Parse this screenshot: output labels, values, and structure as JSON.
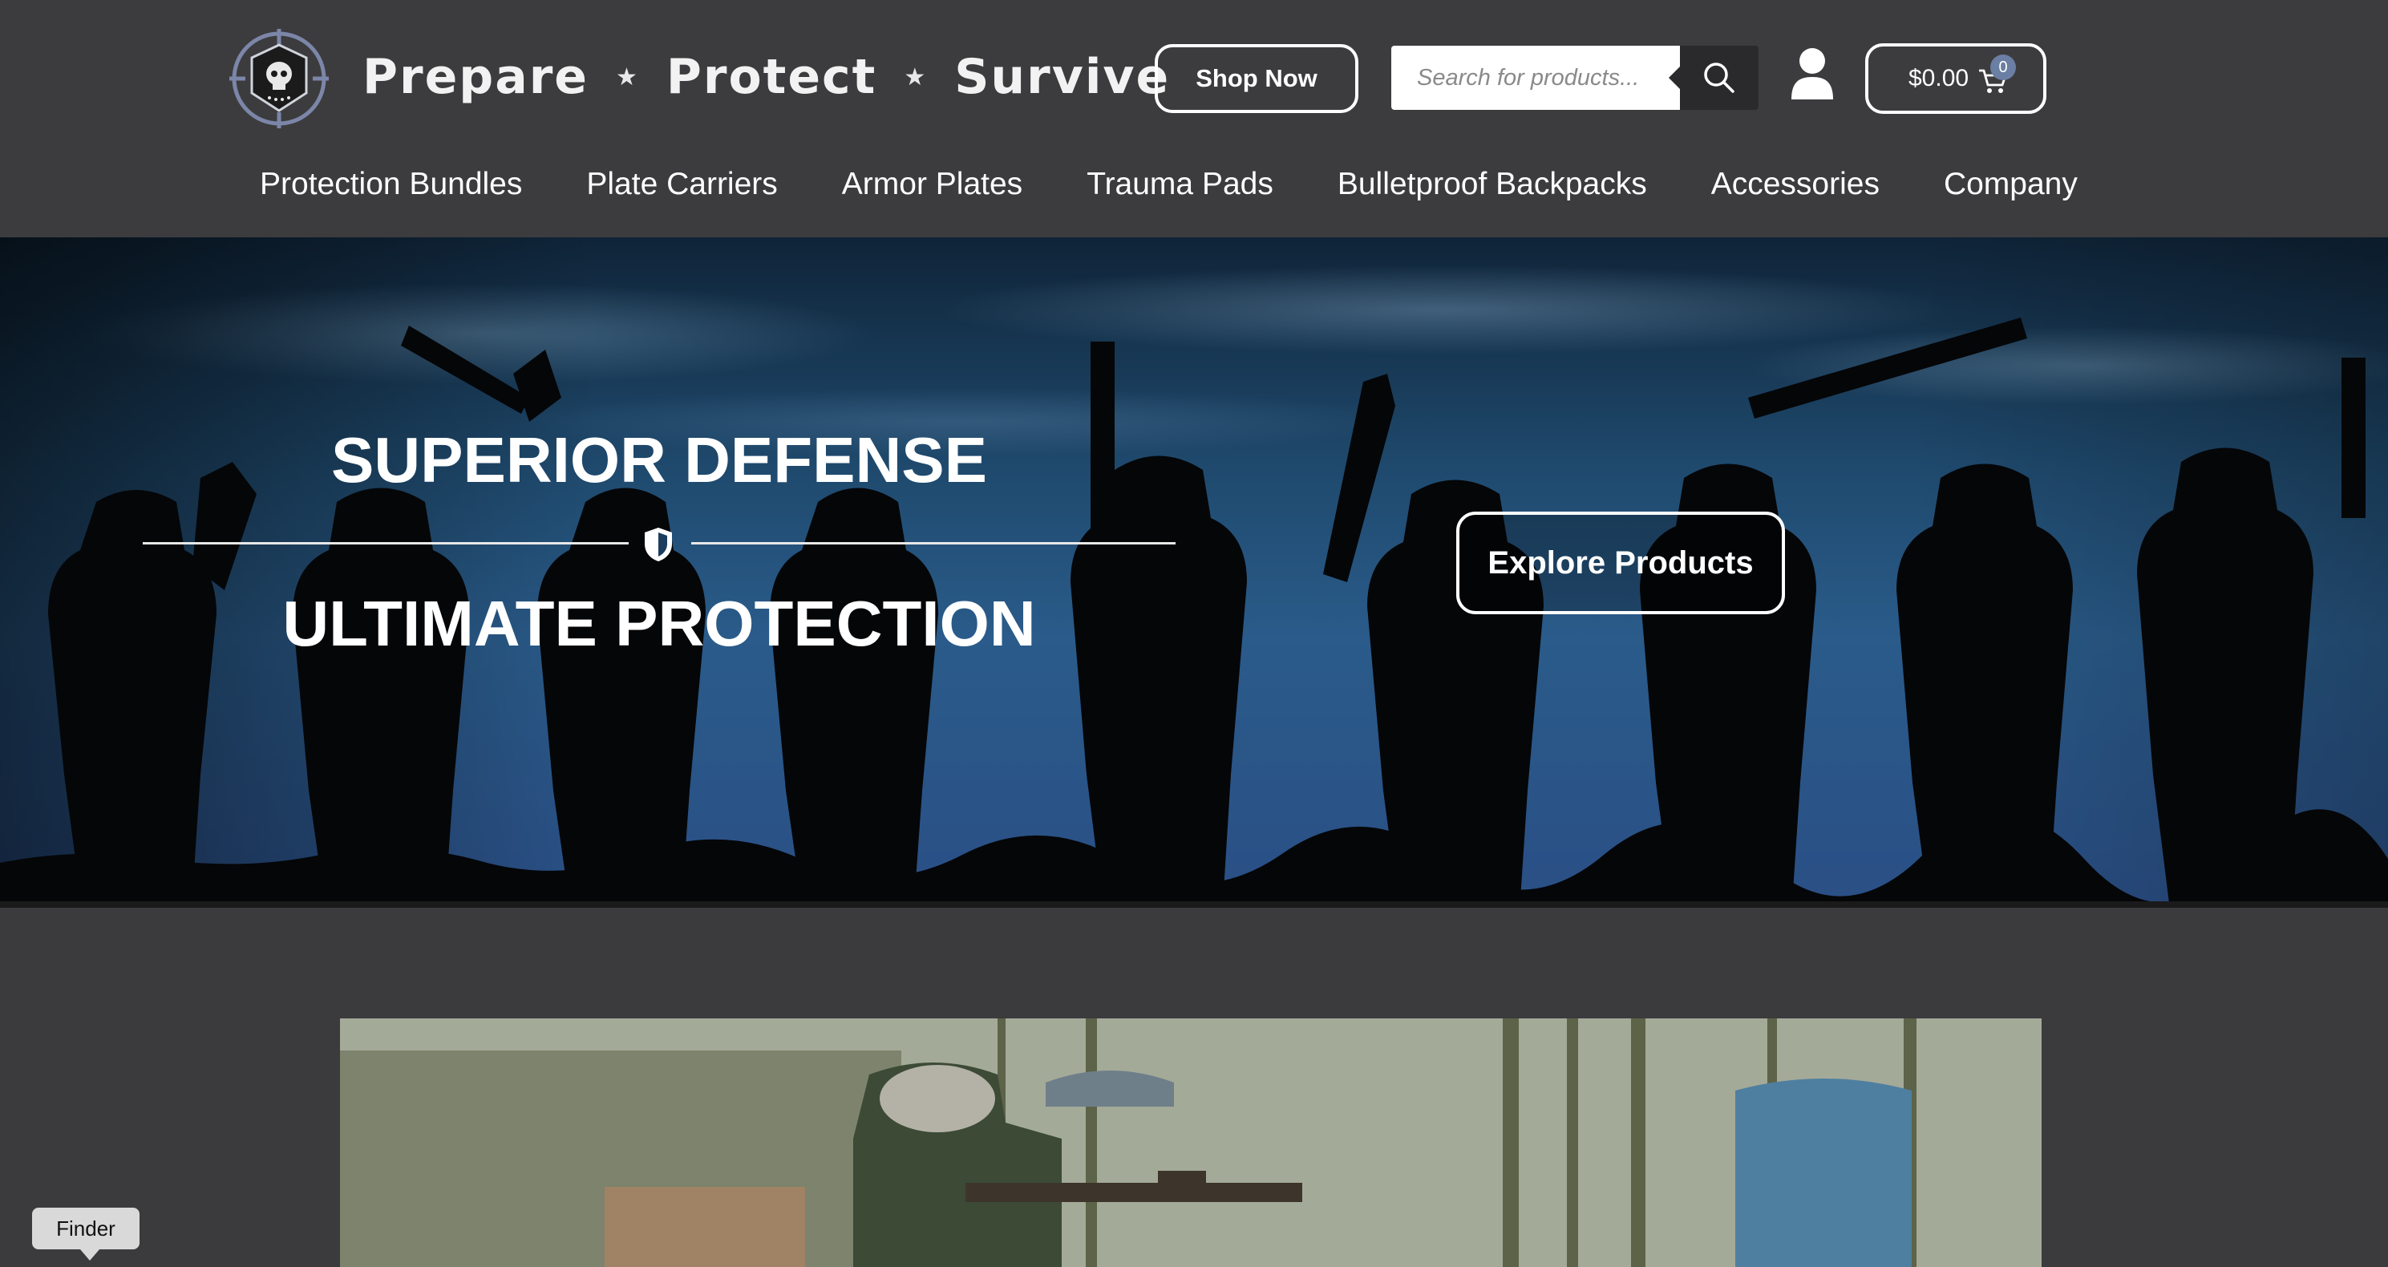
{
  "header": {
    "brand": [
      "Prepare",
      "Protect",
      "Survive"
    ],
    "brand_separator": "★",
    "shop_now_label": "Shop Now",
    "search_placeholder": "Search for products...",
    "cart_total": "$0.00",
    "cart_count": "0"
  },
  "nav": {
    "items": [
      {
        "label": "Protection Bundles"
      },
      {
        "label": "Plate Carriers"
      },
      {
        "label": "Armor Plates"
      },
      {
        "label": "Trauma Pads"
      },
      {
        "label": "Bulletproof Backpacks"
      },
      {
        "label": "Accessories"
      },
      {
        "label": "Company"
      }
    ]
  },
  "hero": {
    "headline_top": "SUPERIOR DEFENSE",
    "headline_bottom": "ULTIMATE PROTECTION",
    "cta_label": "Explore Products"
  },
  "tooltip": {
    "label": "Finder"
  },
  "colors": {
    "header_bg": "#3c3c3e",
    "page_bg": "#3b3b3d",
    "badge": "#6b7ea3"
  }
}
